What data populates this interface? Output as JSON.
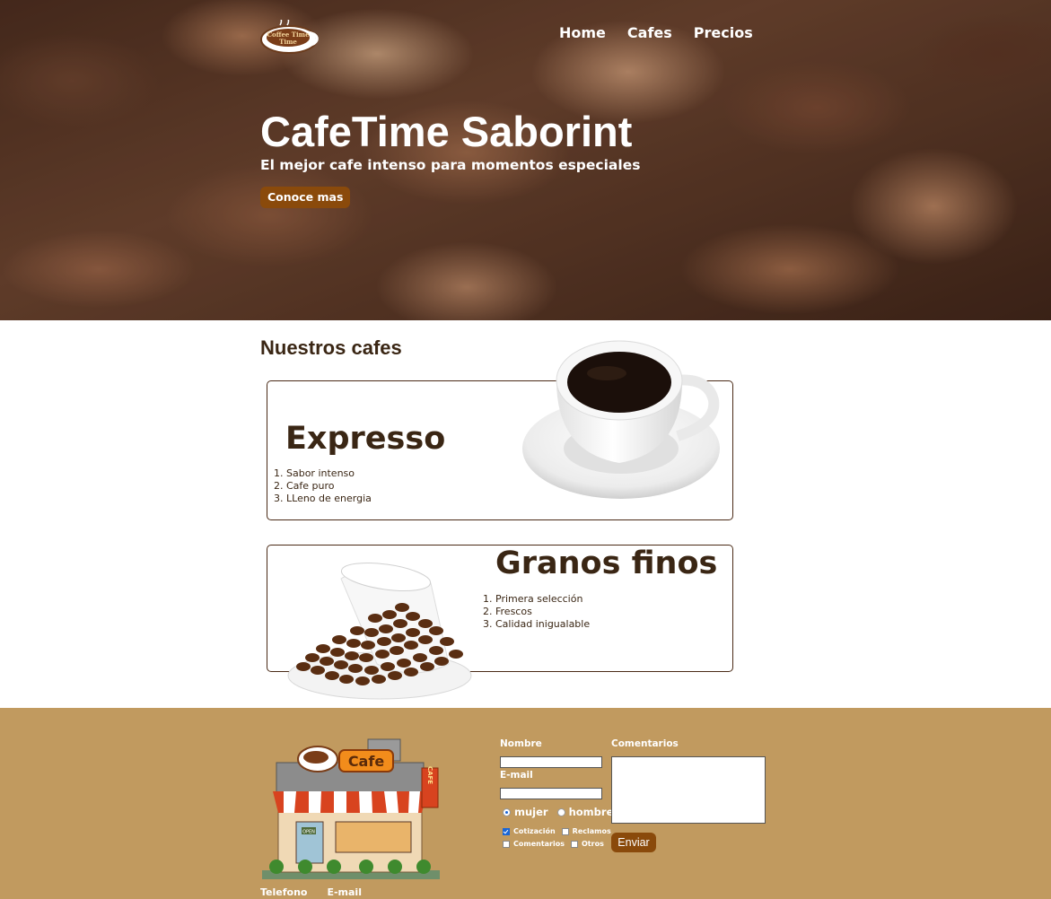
{
  "nav": {
    "logo": {
      "icon": "coffee-time-logo",
      "text": "Coffee Time"
    },
    "links": [
      {
        "label": "Home"
      },
      {
        "label": "Cafes"
      },
      {
        "label": "Precios"
      }
    ]
  },
  "hero": {
    "title": "CafeTime Saborint",
    "subtitle": "El mejor cafe intenso para momentos especiales",
    "button_label": "Conoce mas"
  },
  "cafes": {
    "section_title": "Nuestros cafes",
    "cards": [
      {
        "title": "Expresso",
        "image_icon": "coffee-cup-image",
        "items": [
          "Sabor intenso",
          "Cafe puro",
          "LLeno de energia"
        ]
      },
      {
        "title": "Granos finos",
        "image_icon": "coffee-beans-cup-image",
        "items": [
          "Primera selección",
          "Frescos",
          "Calidad inigualable"
        ]
      }
    ]
  },
  "footer": {
    "shop_image": {
      "icon": "cafe-shop-image",
      "sign": "Cafe",
      "side_sign": "CAFE",
      "door_sign": "OPEN"
    },
    "contact": {
      "phone_label": "Telefono",
      "email_label": "E-mail"
    },
    "form": {
      "name_label": "Nombre",
      "name_value": "",
      "email_label": "E-mail",
      "email_value": "",
      "gender_options": [
        {
          "label": "mujer",
          "selected": true
        },
        {
          "label": "hombre",
          "selected": false
        }
      ],
      "topics": [
        {
          "label": "Cotización",
          "checked": true
        },
        {
          "label": "Reclamos",
          "checked": false
        },
        {
          "label": "Comentarios",
          "checked": false
        },
        {
          "label": "Otros",
          "checked": false
        }
      ],
      "comments_label": "Comentarios",
      "comments_value": "",
      "submit_label": "Enviar"
    }
  },
  "colors": {
    "accent_button": "#8a4a0b",
    "footer_bg": "#c19a5f",
    "card_border": "#4a2a16",
    "text_dark": "#3a2614"
  }
}
